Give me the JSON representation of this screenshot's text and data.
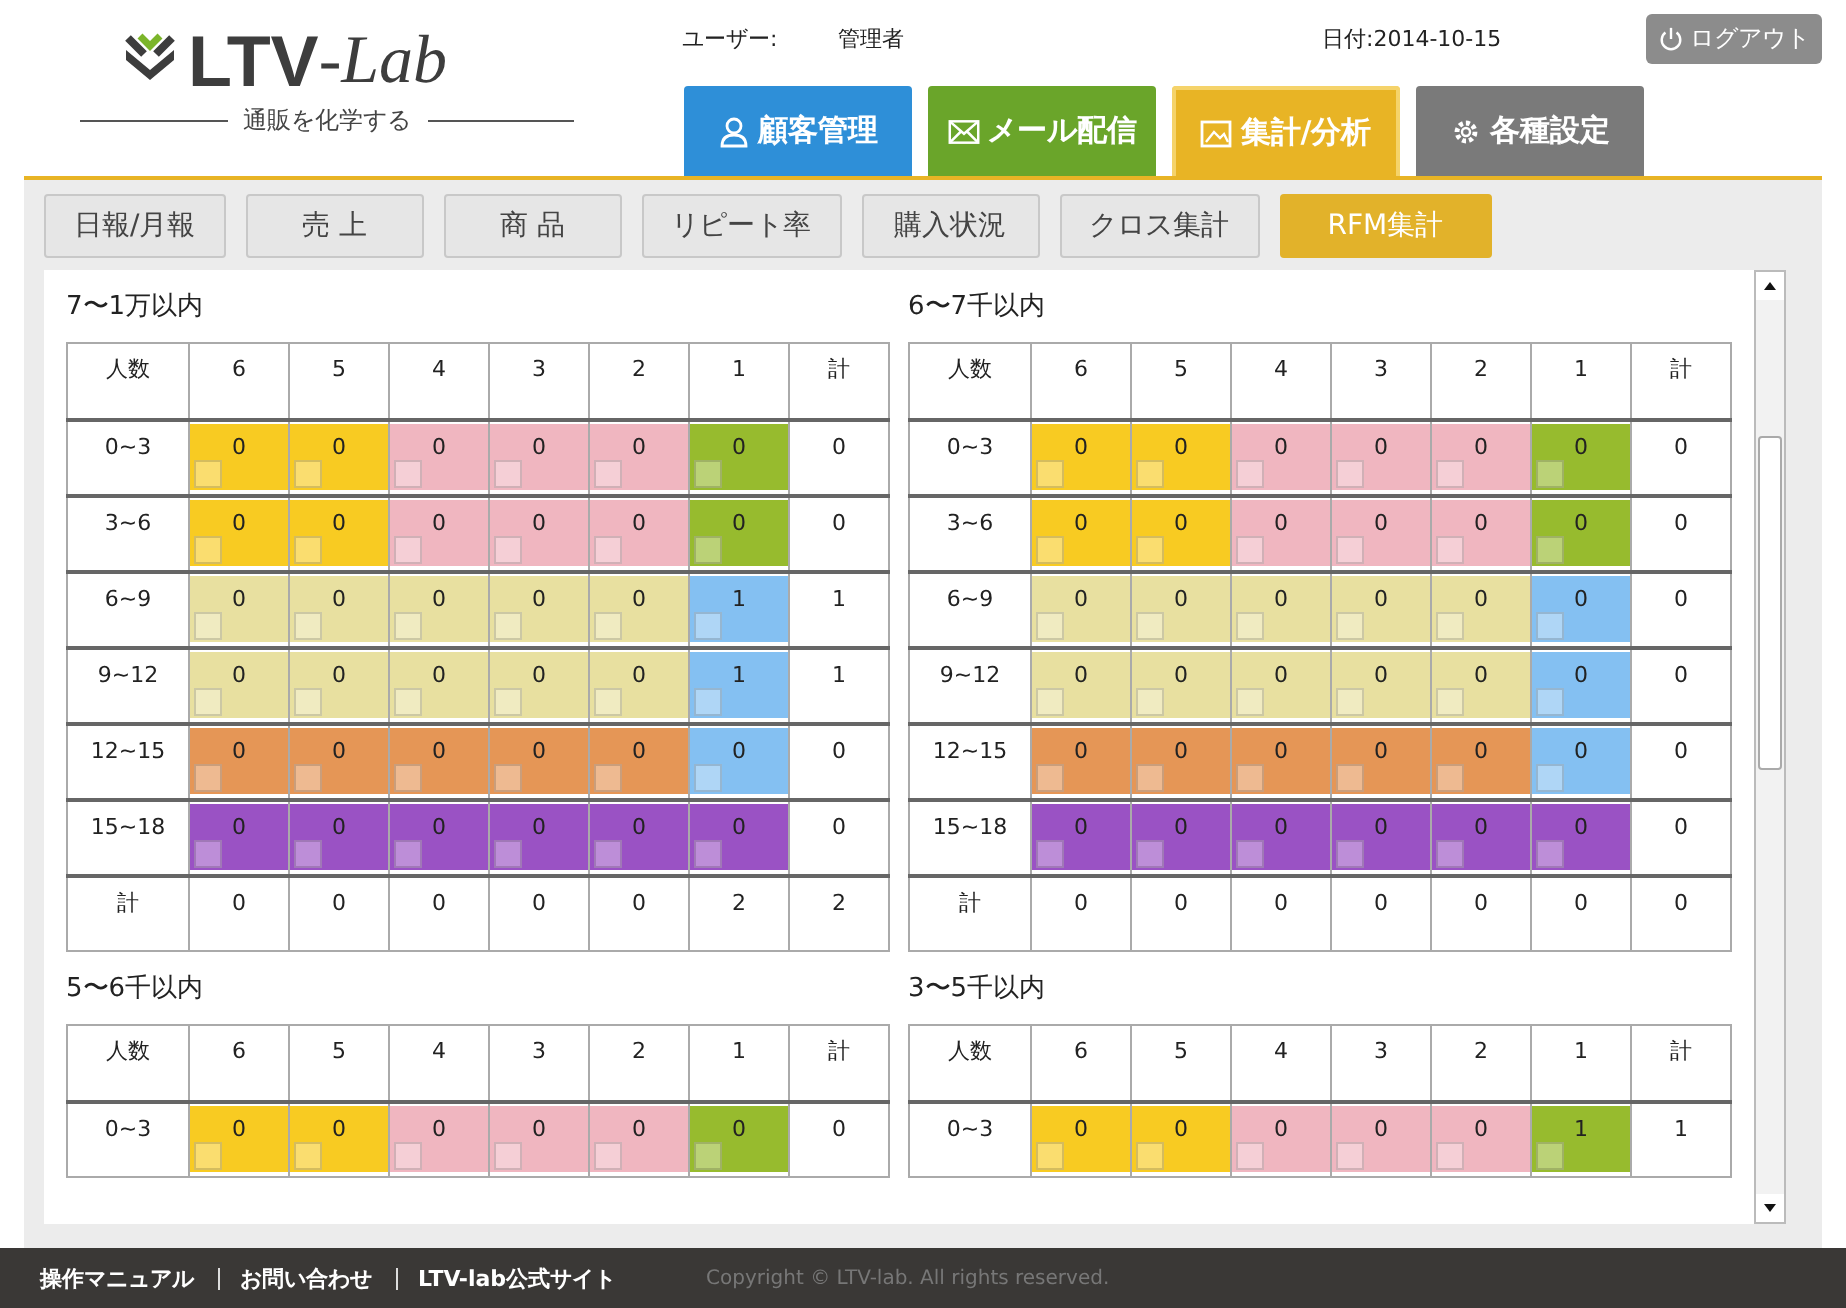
{
  "logo": {
    "main": "LTV",
    "sub": "-Lab",
    "tagline": "通販を化学する"
  },
  "user": {
    "label": "ユーザー:",
    "name": "管理者"
  },
  "date": "日付:2014-10-15",
  "logout": "ログアウト",
  "nav_tabs": [
    {
      "label": "顧客管理",
      "kind": "customers",
      "color": "#2e8fd8",
      "selected": false
    },
    {
      "label": "メール配信",
      "kind": "mail",
      "color": "#6aa52a",
      "selected": false
    },
    {
      "label": "集計/分析",
      "kind": "analytics",
      "color": "#e8b425",
      "selected": true
    },
    {
      "label": "各種設定",
      "kind": "settings",
      "color": "#7a7a7a",
      "selected": false
    }
  ],
  "sub_tabs": [
    {
      "label": "日報/月報",
      "selected": false
    },
    {
      "label": "売 上",
      "selected": false
    },
    {
      "label": "商 品",
      "selected": false
    },
    {
      "label": "リピート率",
      "selected": false
    },
    {
      "label": "購入状況",
      "selected": false
    },
    {
      "label": "クロス集計",
      "selected": false
    },
    {
      "label": "RFM集計",
      "selected": true
    }
  ],
  "tables": [
    {
      "title": "7〜1万以内",
      "corner": "人数",
      "columns": [
        "6",
        "5",
        "4",
        "3",
        "2",
        "1"
      ],
      "total_column": "計",
      "rows": [
        {
          "label": "0~3",
          "cells": [
            {
              "value": "0",
              "color": "#f8cb22"
            },
            {
              "value": "0",
              "color": "#f8cb22"
            },
            {
              "value": "0",
              "color": "#f0b6c0"
            },
            {
              "value": "0",
              "color": "#f0b6c0"
            },
            {
              "value": "0",
              "color": "#f0b6c0"
            },
            {
              "value": "0",
              "color": "#97bb2e"
            }
          ],
          "total": "0"
        },
        {
          "label": "3~6",
          "cells": [
            {
              "value": "0",
              "color": "#f8cb22"
            },
            {
              "value": "0",
              "color": "#f8cb22"
            },
            {
              "value": "0",
              "color": "#f0b6c0"
            },
            {
              "value": "0",
              "color": "#f0b6c0"
            },
            {
              "value": "0",
              "color": "#f0b6c0"
            },
            {
              "value": "0",
              "color": "#97bb2e"
            }
          ],
          "total": "0"
        },
        {
          "label": "6~9",
          "cells": [
            {
              "value": "0",
              "color": "#e8e0a0"
            },
            {
              "value": "0",
              "color": "#e8e0a0"
            },
            {
              "value": "0",
              "color": "#e8e0a0"
            },
            {
              "value": "0",
              "color": "#e8e0a0"
            },
            {
              "value": "0",
              "color": "#e8e0a0"
            },
            {
              "value": "1",
              "color": "#84c0f2"
            }
          ],
          "total": "1"
        },
        {
          "label": "9~12",
          "cells": [
            {
              "value": "0",
              "color": "#e8e0a0"
            },
            {
              "value": "0",
              "color": "#e8e0a0"
            },
            {
              "value": "0",
              "color": "#e8e0a0"
            },
            {
              "value": "0",
              "color": "#e8e0a0"
            },
            {
              "value": "0",
              "color": "#e8e0a0"
            },
            {
              "value": "1",
              "color": "#84c0f2"
            }
          ],
          "total": "1"
        },
        {
          "label": "12~15",
          "cells": [
            {
              "value": "0",
              "color": "#e59656"
            },
            {
              "value": "0",
              "color": "#e59656"
            },
            {
              "value": "0",
              "color": "#e59656"
            },
            {
              "value": "0",
              "color": "#e59656"
            },
            {
              "value": "0",
              "color": "#e59656"
            },
            {
              "value": "0",
              "color": "#84c0f2"
            }
          ],
          "total": "0"
        },
        {
          "label": "15~18",
          "cells": [
            {
              "value": "0",
              "color": "#9a52c4"
            },
            {
              "value": "0",
              "color": "#9a52c4"
            },
            {
              "value": "0",
              "color": "#9a52c4"
            },
            {
              "value": "0",
              "color": "#9a52c4"
            },
            {
              "value": "0",
              "color": "#9a52c4"
            },
            {
              "value": "0",
              "color": "#9a52c4"
            }
          ],
          "total": "0"
        },
        {
          "label": "計",
          "cells": [
            {
              "value": "0"
            },
            {
              "value": "0"
            },
            {
              "value": "0"
            },
            {
              "value": "0"
            },
            {
              "value": "0"
            },
            {
              "value": "2"
            }
          ],
          "total": "2"
        }
      ]
    },
    {
      "title": "6〜7千以内",
      "corner": "人数",
      "columns": [
        "6",
        "5",
        "4",
        "3",
        "2",
        "1"
      ],
      "total_column": "計",
      "rows": [
        {
          "label": "0~3",
          "cells": [
            {
              "value": "0",
              "color": "#f8cb22"
            },
            {
              "value": "0",
              "color": "#f8cb22"
            },
            {
              "value": "0",
              "color": "#f0b6c0"
            },
            {
              "value": "0",
              "color": "#f0b6c0"
            },
            {
              "value": "0",
              "color": "#f0b6c0"
            },
            {
              "value": "0",
              "color": "#97bb2e"
            }
          ],
          "total": "0"
        },
        {
          "label": "3~6",
          "cells": [
            {
              "value": "0",
              "color": "#f8cb22"
            },
            {
              "value": "0",
              "color": "#f8cb22"
            },
            {
              "value": "0",
              "color": "#f0b6c0"
            },
            {
              "value": "0",
              "color": "#f0b6c0"
            },
            {
              "value": "0",
              "color": "#f0b6c0"
            },
            {
              "value": "0",
              "color": "#97bb2e"
            }
          ],
          "total": "0"
        },
        {
          "label": "6~9",
          "cells": [
            {
              "value": "0",
              "color": "#e8e0a0"
            },
            {
              "value": "0",
              "color": "#e8e0a0"
            },
            {
              "value": "0",
              "color": "#e8e0a0"
            },
            {
              "value": "0",
              "color": "#e8e0a0"
            },
            {
              "value": "0",
              "color": "#e8e0a0"
            },
            {
              "value": "0",
              "color": "#84c0f2"
            }
          ],
          "total": "0"
        },
        {
          "label": "9~12",
          "cells": [
            {
              "value": "0",
              "color": "#e8e0a0"
            },
            {
              "value": "0",
              "color": "#e8e0a0"
            },
            {
              "value": "0",
              "color": "#e8e0a0"
            },
            {
              "value": "0",
              "color": "#e8e0a0"
            },
            {
              "value": "0",
              "color": "#e8e0a0"
            },
            {
              "value": "0",
              "color": "#84c0f2"
            }
          ],
          "total": "0"
        },
        {
          "label": "12~15",
          "cells": [
            {
              "value": "0",
              "color": "#e59656"
            },
            {
              "value": "0",
              "color": "#e59656"
            },
            {
              "value": "0",
              "color": "#e59656"
            },
            {
              "value": "0",
              "color": "#e59656"
            },
            {
              "value": "0",
              "color": "#e59656"
            },
            {
              "value": "0",
              "color": "#84c0f2"
            }
          ],
          "total": "0"
        },
        {
          "label": "15~18",
          "cells": [
            {
              "value": "0",
              "color": "#9a52c4"
            },
            {
              "value": "0",
              "color": "#9a52c4"
            },
            {
              "value": "0",
              "color": "#9a52c4"
            },
            {
              "value": "0",
              "color": "#9a52c4"
            },
            {
              "value": "0",
              "color": "#9a52c4"
            },
            {
              "value": "0",
              "color": "#9a52c4"
            }
          ],
          "total": "0"
        },
        {
          "label": "計",
          "cells": [
            {
              "value": "0"
            },
            {
              "value": "0"
            },
            {
              "value": "0"
            },
            {
              "value": "0"
            },
            {
              "value": "0"
            },
            {
              "value": "0"
            }
          ],
          "total": "0"
        }
      ]
    },
    {
      "title": "5〜6千以内",
      "corner": "人数",
      "columns": [
        "6",
        "5",
        "4",
        "3",
        "2",
        "1"
      ],
      "total_column": "計",
      "rows": [
        {
          "label": "0~3",
          "cells": [
            {
              "value": "0",
              "color": "#f8cb22"
            },
            {
              "value": "0",
              "color": "#f8cb22"
            },
            {
              "value": "0",
              "color": "#f0b6c0"
            },
            {
              "value": "0",
              "color": "#f0b6c0"
            },
            {
              "value": "0",
              "color": "#f0b6c0"
            },
            {
              "value": "0",
              "color": "#97bb2e"
            }
          ],
          "total": "0"
        }
      ]
    },
    {
      "title": "3〜5千以内",
      "corner": "人数",
      "columns": [
        "6",
        "5",
        "4",
        "3",
        "2",
        "1"
      ],
      "total_column": "計",
      "rows": [
        {
          "label": "0~3",
          "cells": [
            {
              "value": "0",
              "color": "#f8cb22"
            },
            {
              "value": "0",
              "color": "#f8cb22"
            },
            {
              "value": "0",
              "color": "#f0b6c0"
            },
            {
              "value": "0",
              "color": "#f0b6c0"
            },
            {
              "value": "0",
              "color": "#f0b6c0"
            },
            {
              "value": "1",
              "color": "#97bb2e"
            }
          ],
          "total": "1"
        }
      ]
    }
  ],
  "footer": {
    "links": [
      "操作マニュアル",
      "お問い合わせ",
      "LTV-lab公式サイト"
    ],
    "copyright": "Copyright © LTV-lab. All rights reserved."
  }
}
